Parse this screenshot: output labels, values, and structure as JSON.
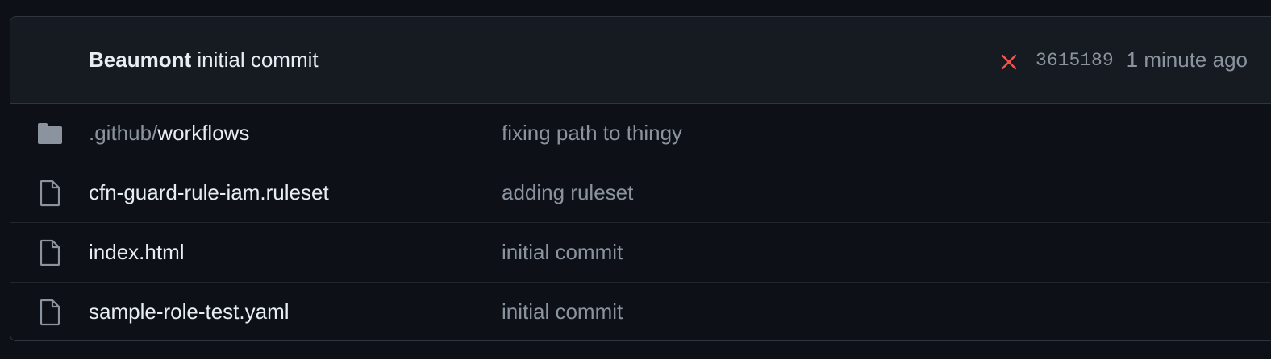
{
  "latest_commit": {
    "author": "Beaumont",
    "message": "initial commit",
    "status": "failed",
    "sha": "3615189",
    "time": "1 minute ago",
    "status_color": "#f85149"
  },
  "files": [
    {
      "type": "folder",
      "icon": "folder-icon",
      "name_prefix": ".github/",
      "name": "workflows",
      "message": "fixing path to thingy"
    },
    {
      "type": "file",
      "icon": "file-icon",
      "name_prefix": "",
      "name": "cfn-guard-rule-iam.ruleset",
      "message": "adding ruleset"
    },
    {
      "type": "file",
      "icon": "file-icon",
      "name_prefix": "",
      "name": "index.html",
      "message": "initial commit"
    },
    {
      "type": "file",
      "icon": "file-icon",
      "name_prefix": "",
      "name": "sample-role-test.yaml",
      "message": "initial commit"
    }
  ]
}
